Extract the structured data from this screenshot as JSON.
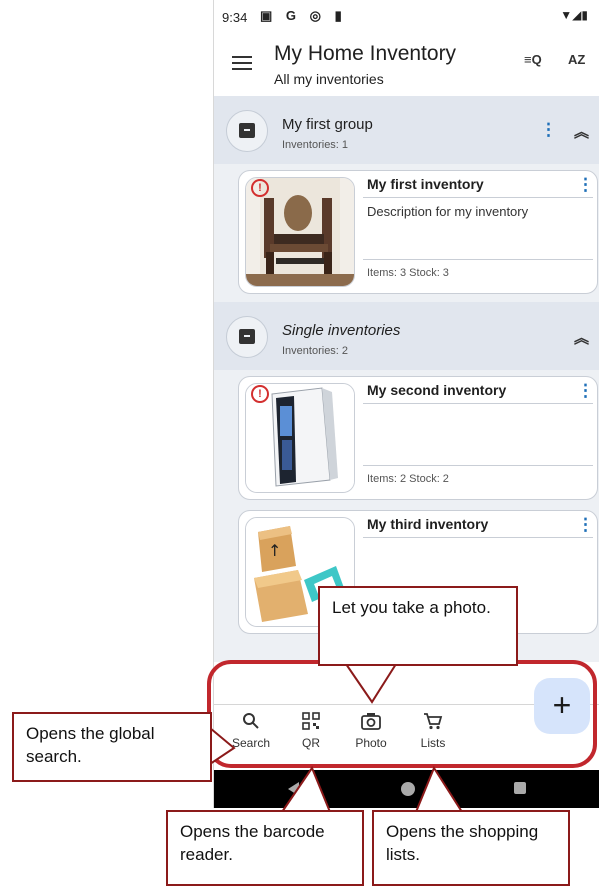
{
  "status_bar": {
    "time": "9:34",
    "icons": "▣ G ◎ ▮",
    "right_icons": "▼◢▮"
  },
  "app_bar": {
    "title": "My Home Inventory",
    "subtitle": "All my inventories",
    "filter_label": "≡Q",
    "sort_label": "AZ"
  },
  "groups": [
    {
      "title": "My first group",
      "count": "Inventories: 1",
      "inventories": [
        {
          "title": "My first inventory",
          "description": "Description for my inventory",
          "stats": "Items: 3   Stock: 3",
          "image": "dining-room"
        }
      ]
    },
    {
      "title": "Single inventories",
      "count": "Inventories: 2",
      "inventories": [
        {
          "title": "My second inventory",
          "description": "",
          "stats": "Items: 2   Stock: 2",
          "image": "pc-case"
        },
        {
          "title": "My third inventory",
          "description": "",
          "stats": "",
          "image": "boxes"
        }
      ]
    }
  ],
  "bottom_nav": {
    "items": [
      {
        "label": "Search",
        "icon": "search-icon"
      },
      {
        "label": "QR",
        "icon": "qr-code-icon"
      },
      {
        "label": "Photo",
        "icon": "camera-icon"
      },
      {
        "label": "Lists",
        "icon": "cart-icon"
      }
    ],
    "fab": "+"
  },
  "callouts": {
    "photo": "Let you take a photo.",
    "search": "Opens the global search.",
    "barcode": "Opens the barcode reader.",
    "lists": "Opens the shopping lists."
  },
  "colors": {
    "accent": "#1e6fb8",
    "callout_border": "#8b1a1a",
    "highlight": "#c1272d",
    "warning": "#d32f2f"
  }
}
